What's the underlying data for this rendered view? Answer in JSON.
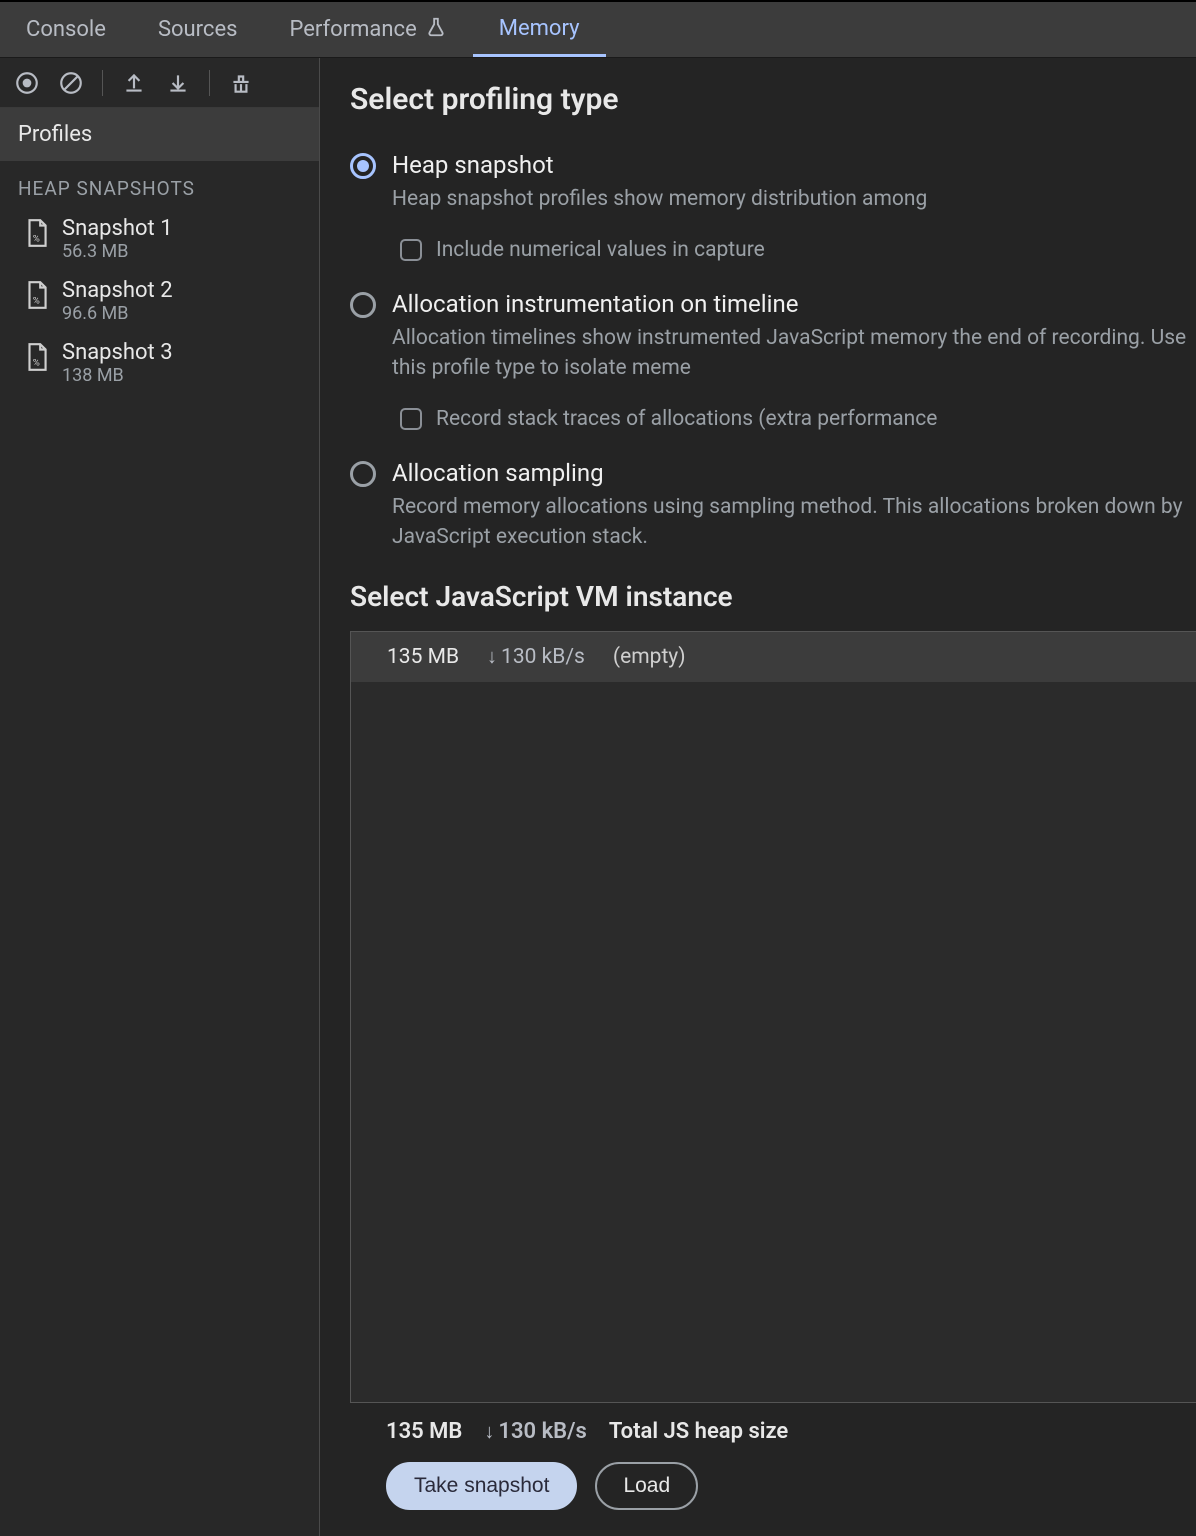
{
  "tabs": {
    "console": "Console",
    "sources": "Sources",
    "performance": "Performance",
    "memory": "Memory"
  },
  "sidebar": {
    "profiles_header": "Profiles",
    "section_label": "HEAP SNAPSHOTS",
    "snapshots": [
      {
        "name": "Snapshot 1",
        "size": "56.3 MB"
      },
      {
        "name": "Snapshot 2",
        "size": "96.6 MB"
      },
      {
        "name": "Snapshot 3",
        "size": "138 MB"
      }
    ]
  },
  "content": {
    "select_type_heading": "Select profiling type",
    "options": {
      "heap": {
        "title": "Heap snapshot",
        "desc": "Heap snapshot profiles show memory distribution among",
        "checkbox_label": "Include numerical values in capture"
      },
      "timeline": {
        "title": "Allocation instrumentation on timeline",
        "desc": "Allocation timelines show instrumented JavaScript memory the end of recording. Use this profile type to isolate meme",
        "checkbox_label": "Record stack traces of allocations (extra performance"
      },
      "sampling": {
        "title": "Allocation sampling",
        "desc": "Record memory allocations using sampling method. This allocations broken down by JavaScript execution stack."
      }
    },
    "vm_heading": "Select JavaScript VM instance",
    "vm_row": {
      "size": "135 MB",
      "rate": "130 kB/s",
      "label": "(empty)"
    }
  },
  "footer": {
    "size": "135 MB",
    "rate": "130 kB/s",
    "total_label": "Total JS heap size",
    "take_snapshot": "Take snapshot",
    "load": "Load"
  }
}
